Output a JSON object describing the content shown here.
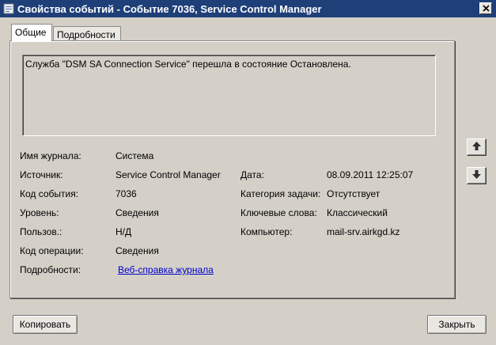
{
  "window": {
    "title": "Свойства событий - Событие 7036, Service Control Manager"
  },
  "tabs": [
    {
      "label": "Общие",
      "active": true
    },
    {
      "label": "Подробности",
      "active": false
    }
  ],
  "message": "Служба \"DSM SA Connection Service\" перешла в состояние Остановлена.",
  "fields": {
    "log_name": {
      "label": "Имя журнала:",
      "value": "Система"
    },
    "source": {
      "label": "Источник:",
      "value": "Service Control Manager"
    },
    "event_id": {
      "label": "Код события:",
      "value": "7036"
    },
    "level": {
      "label": "Уровень:",
      "value": "Сведения"
    },
    "user": {
      "label": "Пользов.:",
      "value": "Н/Д"
    },
    "opcode": {
      "label": "Код операции:",
      "value": "Сведения"
    },
    "details": {
      "label": "Подробности:",
      "value": "Веб-справка журнала"
    },
    "date": {
      "label": "Дата:",
      "value": "08.09.2011 12:25:07"
    },
    "task_category": {
      "label": "Категория задачи:",
      "value": "Отсутствует"
    },
    "keywords": {
      "label": "Ключевые слова:",
      "value": "Классический"
    },
    "computer": {
      "label": "Компьютер:",
      "value": "mail-srv.airkgd.kz"
    }
  },
  "buttons": {
    "copy": "Копировать",
    "close": "Закрыть"
  },
  "icons": {
    "title": "event-viewer-icon",
    "up": "arrow-up-icon",
    "down": "arrow-down-icon",
    "close": "close-icon"
  },
  "colors": {
    "titlebar": "#1e3f78",
    "link": "#0000cc",
    "background": "#d4d0c8"
  }
}
